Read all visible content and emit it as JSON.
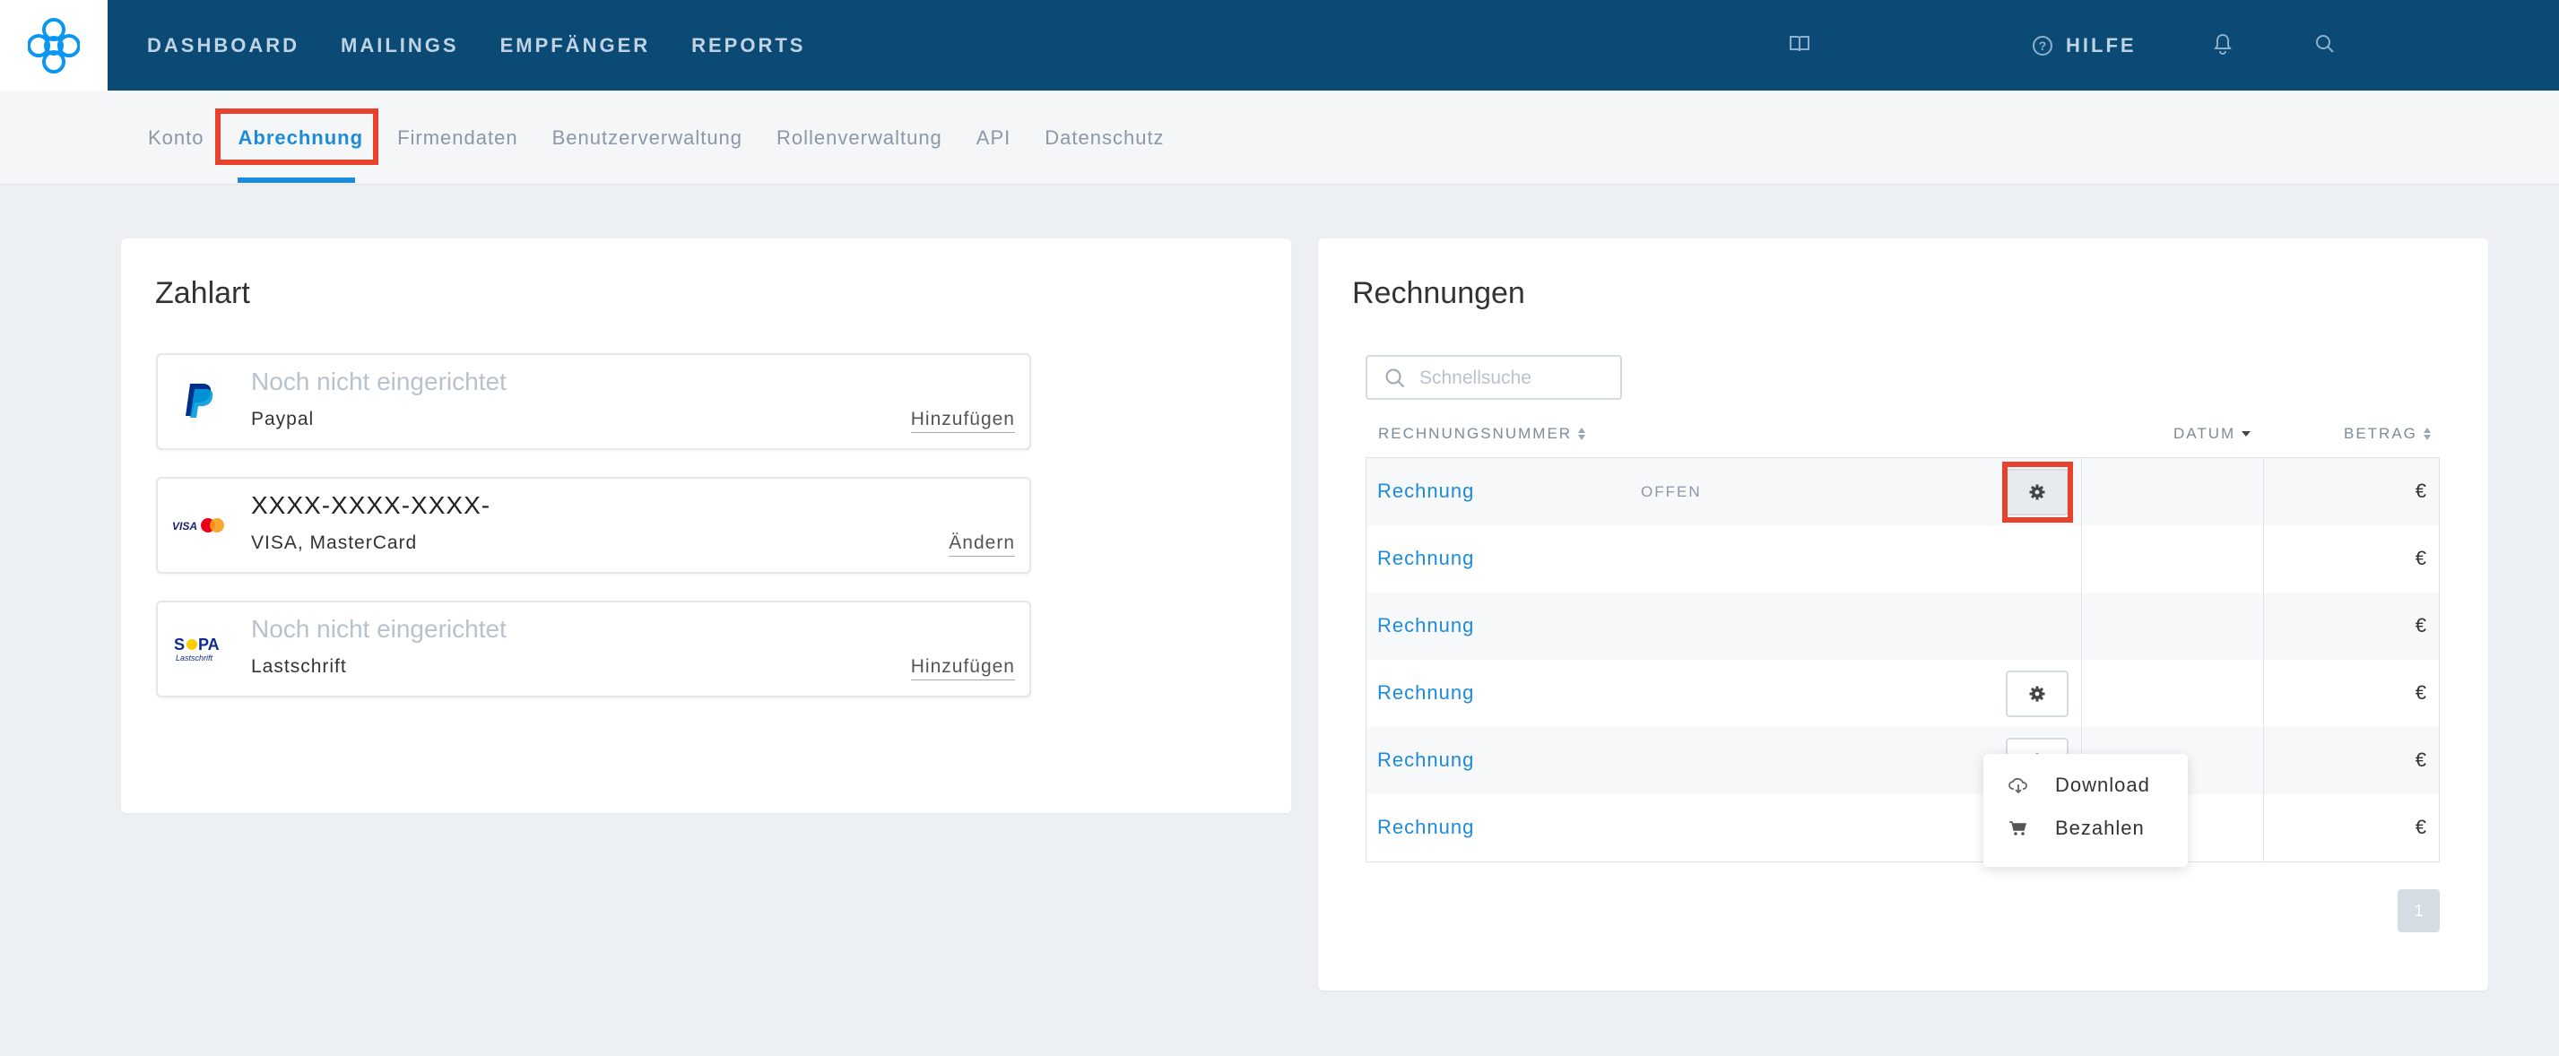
{
  "header": {
    "logo": "sendinblue-logo",
    "nav": [
      "DASHBOARD",
      "MAILINGS",
      "EMPFÄNGER",
      "REPORTS"
    ],
    "help_label": "HILFE",
    "icons": [
      "book-icon",
      "help-circle-icon",
      "bell-icon",
      "search-icon"
    ],
    "colors": {
      "bar": "#0a4a75",
      "accent": "#1c8bd9",
      "highlight": "#e8412c"
    }
  },
  "subnav": {
    "items": [
      "Konto",
      "Abrechnung",
      "Firmendaten",
      "Benutzerverwaltung",
      "Rollenverwaltung",
      "API",
      "Datenschutz"
    ],
    "active": "Abrechnung"
  },
  "payment": {
    "title": "Zahlart",
    "methods": [
      {
        "logo": "paypal-logo",
        "main": "Noch nicht eingerichtet",
        "sub": "Paypal",
        "action": "Hinzufügen"
      },
      {
        "logo": "visa-mastercard-logo",
        "main": "XXXX-XXXX-XXXX-",
        "sub": "VISA, MasterCard",
        "action": "Ändern"
      },
      {
        "logo": "sepa-lastschrift-logo",
        "main": "Noch nicht eingerichtet",
        "sub": "Lastschrift",
        "action": "Hinzufügen"
      }
    ]
  },
  "invoices": {
    "title": "Rechnungen",
    "search_placeholder": "Schnellsuche",
    "columns": {
      "number": "RECHNUNGSNUMMER",
      "date": "DATUM",
      "amount": "BETRAG"
    },
    "rows": [
      {
        "label": "Rechnung",
        "status": "OFFEN",
        "amount": "€"
      },
      {
        "label": "Rechnung",
        "status": "",
        "amount": "€"
      },
      {
        "label": "Rechnung",
        "status": "",
        "amount": "€"
      },
      {
        "label": "Rechnung",
        "status": "",
        "amount": "€"
      },
      {
        "label": "Rechnung",
        "status": "",
        "amount": "€"
      },
      {
        "label": "Rechnung",
        "status": "",
        "amount": "€"
      }
    ],
    "dropdown": [
      {
        "icon": "cloud-download-icon",
        "label": "Download"
      },
      {
        "icon": "cart-icon",
        "label": "Bezahlen"
      }
    ],
    "pagination": {
      "current": "1"
    }
  }
}
